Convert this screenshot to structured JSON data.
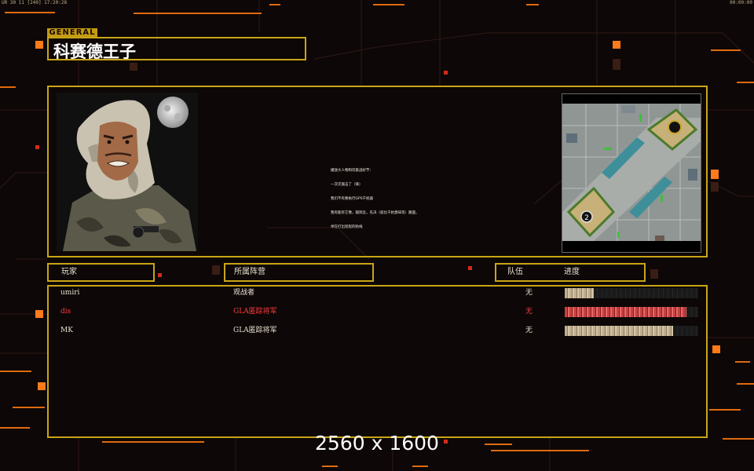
{
  "hud": {
    "top_left": "UR 30 11 [240] 17:20:28",
    "top_right": "00:00:00"
  },
  "general": {
    "tag": "GENERAL",
    "name": "科赛德王子"
  },
  "briefing": {
    "lines": [
      "播放大人物和玩家战好节：",
      "一次次施击了（锋）",
      "我们不有要执行GPS干扰器",
      "我有能有它像，辅到吾，先决（就比干抗意味等）路面，",
      "举在打出巡程的防线"
    ]
  },
  "table": {
    "headers": {
      "player": "玩家",
      "faction": "所属阵营",
      "team": "队伍",
      "progress": "进度"
    },
    "rows": [
      {
        "player": "umiri",
        "faction": "观战者",
        "team": "无",
        "progress": 0.22,
        "style": "tan"
      },
      {
        "player": "dis",
        "faction": "GLA匿踪将军",
        "team": "无",
        "progress": 0.91,
        "style": "red"
      },
      {
        "player": "MK",
        "faction": "GLA匿踪将军",
        "team": "无",
        "progress": 0.81,
        "style": "tan"
      }
    ]
  },
  "overlay": {
    "resolution": "2560 x 1600"
  },
  "colors": {
    "frame": "#c9a516",
    "accent_orange": "#ff7a1a",
    "enemy_red": "#ff3a3a"
  }
}
